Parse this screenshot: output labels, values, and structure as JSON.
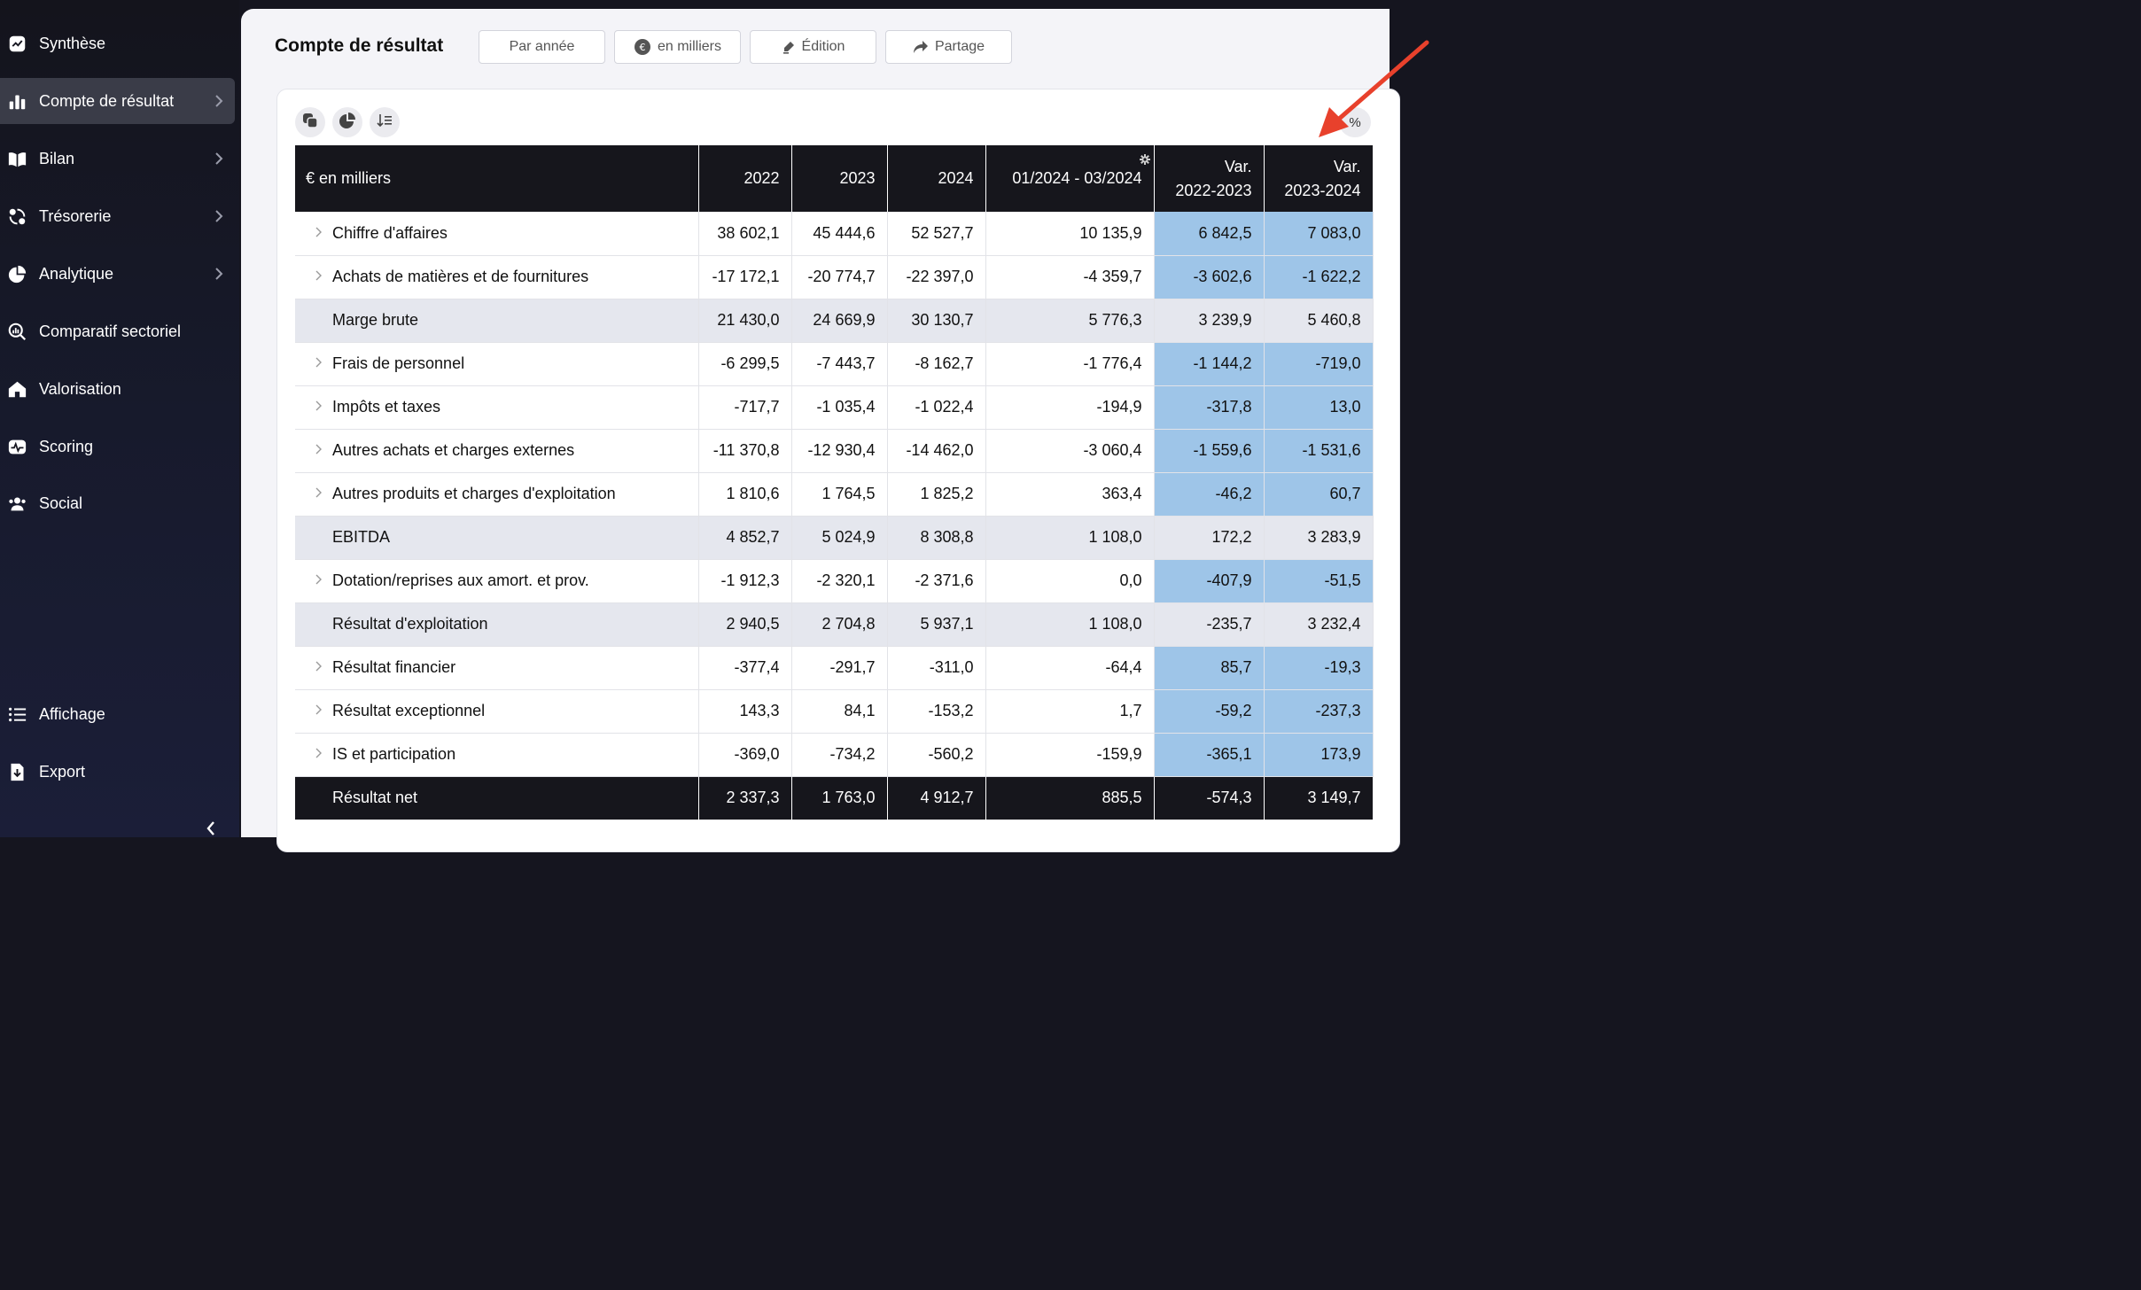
{
  "sidebar": {
    "items": [
      {
        "label": "Synthèse",
        "icon": "chart-line-icon",
        "has_chevron": false
      },
      {
        "label": "Compte de résultat",
        "icon": "bar-chart-icon",
        "has_chevron": true,
        "active": true
      },
      {
        "label": "Bilan",
        "icon": "book-icon",
        "has_chevron": true
      },
      {
        "label": "Trésorerie",
        "icon": "cycle-icon",
        "has_chevron": true
      },
      {
        "label": "Analytique",
        "icon": "pie-chart-icon",
        "has_chevron": true
      },
      {
        "label": "Comparatif sectoriel",
        "icon": "magnify-chart-icon",
        "has_chevron": false
      },
      {
        "label": "Valorisation",
        "icon": "home-icon",
        "has_chevron": false
      },
      {
        "label": "Scoring",
        "icon": "pulse-icon",
        "has_chevron": false
      },
      {
        "label": "Social",
        "icon": "users-icon",
        "has_chevron": false
      }
    ],
    "bottom_items": [
      {
        "label": "Affichage",
        "icon": "list-icon"
      },
      {
        "label": "Export",
        "icon": "file-download-icon"
      }
    ]
  },
  "header": {
    "title": "Compte de résultat",
    "buttons": {
      "period": "Par année",
      "unit": "en milliers",
      "edit": "Édition",
      "share": "Partage"
    }
  },
  "table": {
    "toggle_label": "%",
    "columns": [
      "€ en milliers",
      "2022",
      "2023",
      "2024",
      "01/2024 - 03/2024",
      "Var.\n2022-2023",
      "Var.\n2023-2024"
    ],
    "rows": [
      {
        "label": "Chiffre d'affaires",
        "values": [
          "38 602,1",
          "45 444,6",
          "52 527,7",
          "10 135,9",
          "6 842,5",
          "7 083,0"
        ],
        "type": "detail"
      },
      {
        "label": "Achats de matières et de fournitures",
        "values": [
          "-17 172,1",
          "-20 774,7",
          "-22 397,0",
          "-4 359,7",
          "-3 602,6",
          "-1 622,2"
        ],
        "type": "detail"
      },
      {
        "label": "Marge brute",
        "values": [
          "21 430,0",
          "24 669,9",
          "30 130,7",
          "5 776,3",
          "3 239,9",
          "5 460,8"
        ],
        "type": "subtotal"
      },
      {
        "label": "Frais de personnel",
        "values": [
          "-6 299,5",
          "-7 443,7",
          "-8 162,7",
          "-1 776,4",
          "-1 144,2",
          "-719,0"
        ],
        "type": "detail"
      },
      {
        "label": "Impôts et taxes",
        "values": [
          "-717,7",
          "-1 035,4",
          "-1 022,4",
          "-194,9",
          "-317,8",
          "13,0"
        ],
        "type": "detail"
      },
      {
        "label": "Autres achats et charges externes",
        "values": [
          "-11 370,8",
          "-12 930,4",
          "-14 462,0",
          "-3 060,4",
          "-1 559,6",
          "-1 531,6"
        ],
        "type": "detail"
      },
      {
        "label": "Autres produits et charges d'exploitation",
        "values": [
          "1 810,6",
          "1 764,5",
          "1 825,2",
          "363,4",
          "-46,2",
          "60,7"
        ],
        "type": "detail"
      },
      {
        "label": "EBITDA",
        "values": [
          "4 852,7",
          "5 024,9",
          "8 308,8",
          "1 108,0",
          "172,2",
          "3 283,9"
        ],
        "type": "subtotal"
      },
      {
        "label": "Dotation/reprises aux amort. et prov.",
        "values": [
          "-1 912,3",
          "-2 320,1",
          "-2 371,6",
          "0,0",
          "-407,9",
          "-51,5"
        ],
        "type": "detail"
      },
      {
        "label": "Résultat d'exploitation",
        "values": [
          "2 940,5",
          "2 704,8",
          "5 937,1",
          "1 108,0",
          "-235,7",
          "3 232,4"
        ],
        "type": "subtotal"
      },
      {
        "label": "Résultat financier",
        "values": [
          "-377,4",
          "-291,7",
          "-311,0",
          "-64,4",
          "85,7",
          "-19,3"
        ],
        "type": "detail"
      },
      {
        "label": "Résultat exceptionnel",
        "values": [
          "143,3",
          "84,1",
          "-153,2",
          "1,7",
          "-59,2",
          "-237,3"
        ],
        "type": "detail"
      },
      {
        "label": "IS et participation",
        "values": [
          "-369,0",
          "-734,2",
          "-560,2",
          "-159,9",
          "-365,1",
          "173,9"
        ],
        "type": "detail"
      },
      {
        "label": "Résultat net",
        "values": [
          "2 337,3",
          "1 763,0",
          "4 912,7",
          "885,5",
          "-574,3",
          "3 149,7"
        ],
        "type": "total"
      }
    ]
  },
  "colors": {
    "sidebar_bg": "#15151f",
    "active_item": "#3a3c48",
    "header_bg": "#16161c",
    "variance_cell": "#9ec5e8",
    "subtotal_row": "#e5e7ee",
    "annotation_arrow": "#e8412c"
  }
}
